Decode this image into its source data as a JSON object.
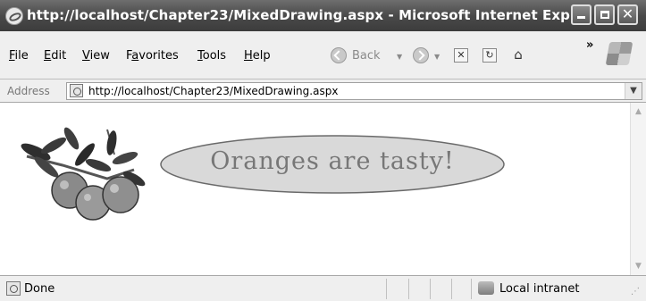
{
  "window": {
    "title": "http://localhost/Chapter23/MixedDrawing.aspx - Microsoft Internet Expl...",
    "buttons": [
      "minimize",
      "maximize",
      "close"
    ]
  },
  "menu": [
    {
      "label": "File",
      "key": "F",
      "rest": "ile"
    },
    {
      "label": "Edit",
      "key": "E",
      "rest": "dit"
    },
    {
      "label": "View",
      "key": "V",
      "rest": "iew"
    },
    {
      "label": "Favorites",
      "key": "a",
      "pre": "F",
      "rest": "vorites"
    },
    {
      "label": "Tools",
      "key": "T",
      "rest": "ools"
    },
    {
      "label": "Help",
      "key": "H",
      "rest": "elp"
    }
  ],
  "toolbar": {
    "back_label": "Back",
    "chevron": "»",
    "icons": [
      "back-icon",
      "forward-icon",
      "stop-icon",
      "refresh-icon",
      "home-icon",
      "windows-logo-icon"
    ]
  },
  "address": {
    "label": "Address",
    "url": "http://localhost/Chapter23/MixedDrawing.aspx"
  },
  "content": {
    "banner_text": "Oranges are tasty!",
    "colors": {
      "ellipse_fill": "#d9d9d9",
      "ellipse_stroke": "#6a6a6a",
      "text": "#777777"
    }
  },
  "status": {
    "text": "Done",
    "zone": "Local intranet"
  }
}
